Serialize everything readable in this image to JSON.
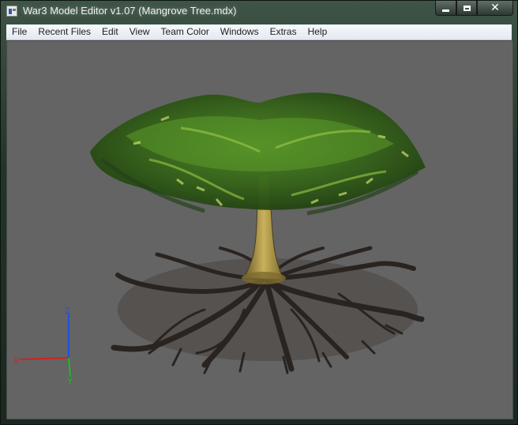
{
  "window": {
    "title": "War3 Model Editor v1.07 (Mangrove Tree.mdx)"
  },
  "caption_buttons": {
    "minimize": "minimize-icon",
    "maximize": "maximize-icon",
    "close": "close-icon",
    "close_glyph": "✕"
  },
  "menu": {
    "items": [
      "File",
      "Recent Files",
      "Edit",
      "View",
      "Team Color",
      "Windows",
      "Extras",
      "Help"
    ]
  },
  "viewport": {
    "background": "#646464",
    "axis": {
      "x_label": "X",
      "y_label": "Y",
      "z_label": "Z",
      "x_color": "#d42020",
      "y_color": "#22b822",
      "z_color": "#2050e0"
    }
  }
}
